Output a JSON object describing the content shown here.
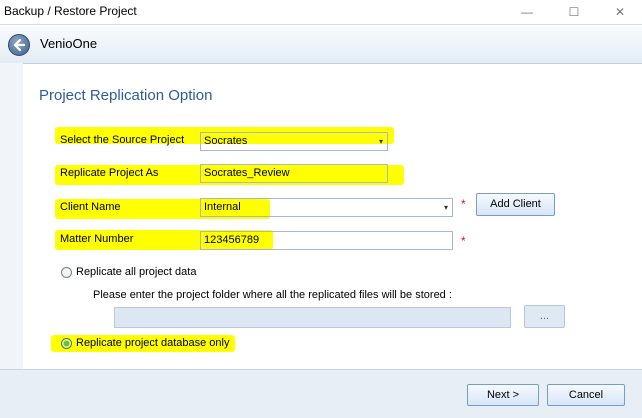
{
  "window": {
    "title": "Backup / Restore Project",
    "controls": {
      "minimize": "—",
      "maximize": "☐",
      "close": "✕"
    }
  },
  "toolbar": {
    "app_name": "VenioOne",
    "back_icon": "back-arrow-icon"
  },
  "page": {
    "title": "Project Replication Option"
  },
  "form": {
    "source_project": {
      "label": "Select the Source Project",
      "value": "Socrates",
      "caret": "▾"
    },
    "replicate_as": {
      "label": "Replicate Project As",
      "value": "Socrates_Review"
    },
    "client_name": {
      "label": "Client Name",
      "value": "Internal",
      "caret": "▾",
      "required": "*"
    },
    "add_client": {
      "label": "Add Client"
    },
    "matter_number": {
      "label": "Matter Number",
      "value": "123456789",
      "required": "*"
    },
    "option_all": {
      "label": "Replicate all project data",
      "selected": false
    },
    "folder_hint": "Please enter the project folder where all the replicated files will be stored :",
    "folder_path": {
      "value": ""
    },
    "browse": {
      "label": "..."
    },
    "option_db": {
      "label": "Replicate project database only",
      "selected": true
    }
  },
  "footer": {
    "next": "Next >",
    "cancel": "Cancel"
  },
  "colors": {
    "highlight": "#ffff00",
    "title_blue": "#2e5d9a",
    "required_red": "#e0141e"
  }
}
